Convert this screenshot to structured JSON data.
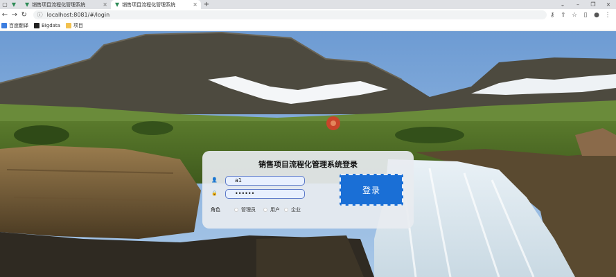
{
  "browser": {
    "tabs": [
      {
        "label": ""
      },
      {
        "label": "销售项目流程化管理系统"
      },
      {
        "label": "销售项目流程化管理系统"
      }
    ],
    "url": "localhost:8081/#/login",
    "bookmarks": [
      {
        "label": "百度翻译"
      },
      {
        "label": "Bigdata"
      },
      {
        "label": "项目"
      }
    ]
  },
  "login": {
    "title": "销售项目流程化管理系统登录",
    "username_value": "a1",
    "password_value": "••••••",
    "role_label": "角色",
    "roles": [
      "管理员",
      "用户",
      "企业"
    ],
    "submit_label": "登录"
  }
}
